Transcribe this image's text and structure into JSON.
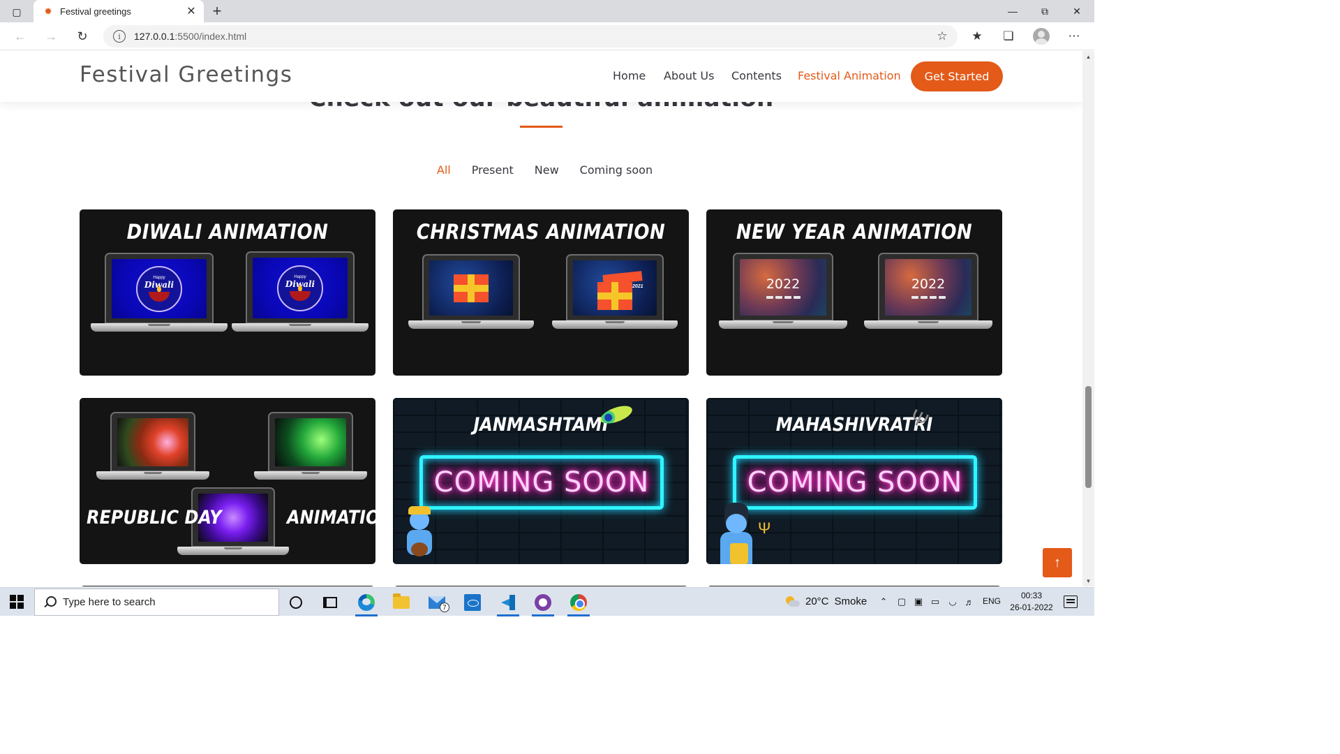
{
  "browser": {
    "tab_title": "Festival greetings",
    "url_host": "127.0.0.1",
    "url_rest": ":5500/index.html",
    "tab_icons": {
      "sidebar": "tab-actions-icon",
      "favicon": "fireworks-icon",
      "close": "close-icon",
      "new_tab": "plus-icon"
    },
    "window_controls": [
      "minimize-icon",
      "restore-icon",
      "close-icon"
    ]
  },
  "site": {
    "logo": "Festival Greetings",
    "nav": [
      {
        "label": "Home",
        "active": false
      },
      {
        "label": "About Us",
        "active": false
      },
      {
        "label": "Contents",
        "active": false
      },
      {
        "label": "Festival Animation",
        "active": true
      }
    ],
    "cta_label": "Get Started",
    "accent_color": "#e35a19"
  },
  "section": {
    "title": "Check out our beautiful animation",
    "filters": [
      {
        "label": "All",
        "active": true
      },
      {
        "label": "Present",
        "active": false
      },
      {
        "label": "New",
        "active": false
      },
      {
        "label": "Coming soon",
        "active": false
      }
    ]
  },
  "cards": {
    "diwali": {
      "title": "DIWALI ANIMATION",
      "screen_happy": "Happy",
      "screen_word": "Diwali"
    },
    "christmas": {
      "title": "CHRISTMAS ANIMATION",
      "gift_label": "CHRISTMAS 2021"
    },
    "newyear": {
      "title": "NEW YEAR ANIMATION",
      "year": "2022"
    },
    "republic": {
      "title_left": "REPUBLIC DAY",
      "title_right": "ANIMATION"
    },
    "janmashtami": {
      "title": "JANMASHTAMI",
      "banner": "COMING SOON"
    },
    "mahashivratri": {
      "title": "MAHASHIVRATRI",
      "banner": "COMING SOON"
    }
  },
  "taskbar": {
    "search_placeholder": "Type here to search",
    "mail_badge": "7",
    "weather_temp": "20°C",
    "weather_desc": "Smoke",
    "language": "ENG",
    "time": "00:33",
    "date": "26-01-2022"
  }
}
